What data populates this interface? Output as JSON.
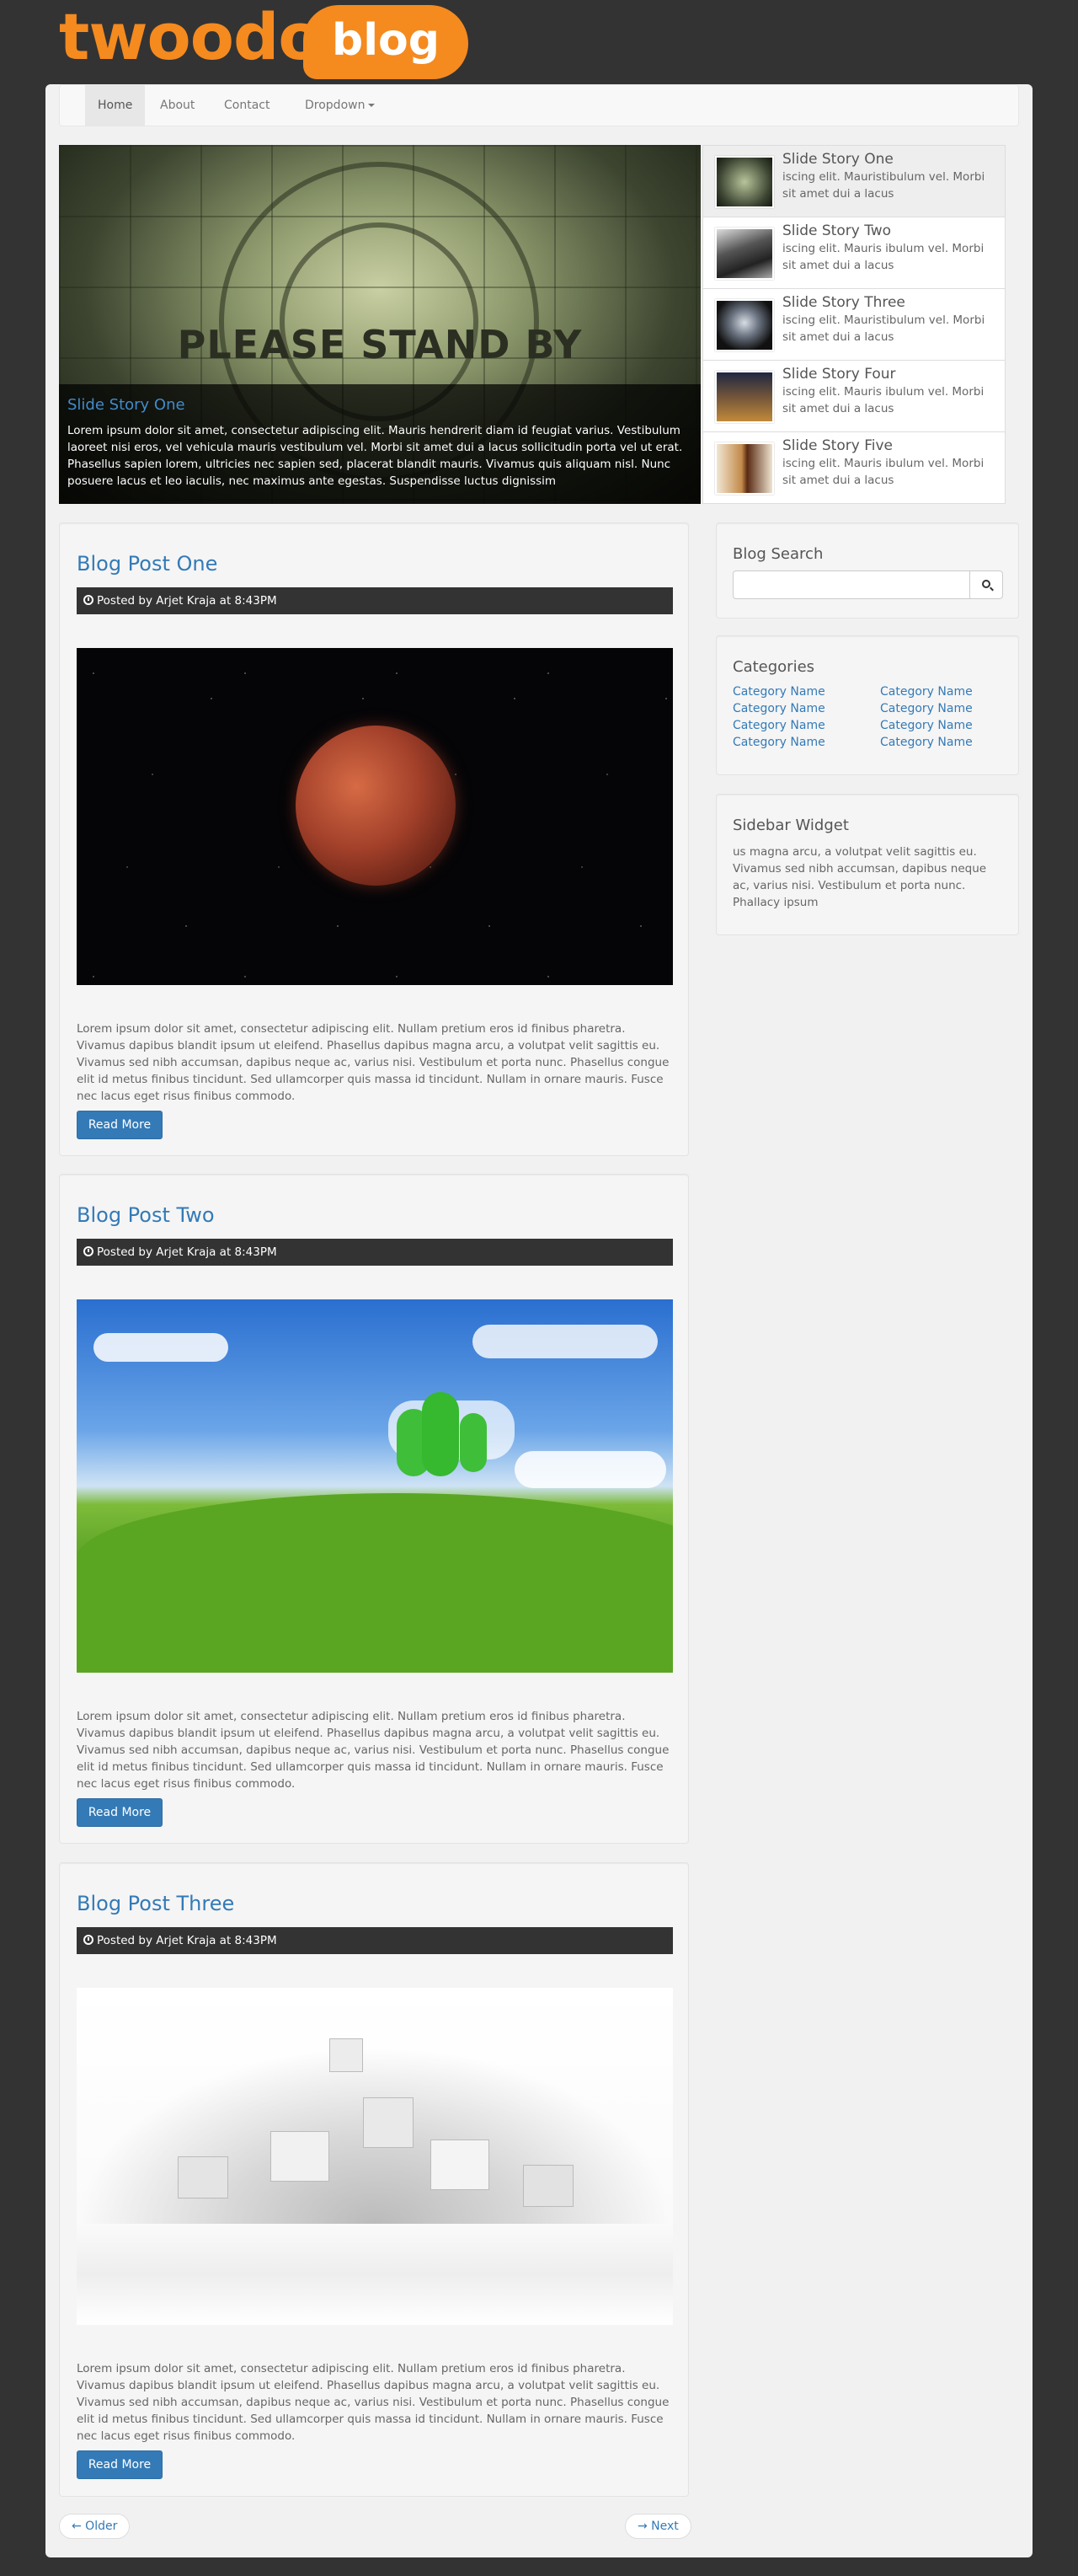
{
  "brand": {
    "name": "twoodo",
    "badge": "blog",
    "accent": "#f58a1f"
  },
  "nav": {
    "items": [
      {
        "label": "Home",
        "active": true
      },
      {
        "label": "About"
      },
      {
        "label": "Contact"
      },
      {
        "label": "Dropdown"
      }
    ]
  },
  "hero": {
    "image_text": "PLEASE STAND BY",
    "caption_title": "Slide Story One",
    "caption_text": "Lorem ipsum dolor sit amet, consectetur adipiscing elit. Mauris hendrerit diam id feugiat varius. Vestibulum laoreet nisi eros, vel vehicula mauris vestibulum vel. Morbi sit amet dui a lacus sollicitudin porta vel ut erat. Phasellus sapien lorem, ultricies nec sapien sed, placerat blandit mauris. Vivamus quis aliquam nisl. Nunc posuere lacus et leo iaculis, nec maximus ante egestas. Suspendisse luctus dignissim"
  },
  "slides": [
    {
      "title": "Slide Story One",
      "desc": "iscing elit. Mauristibulum vel. Morbi sit amet dui a lacus",
      "active": true
    },
    {
      "title": "Slide Story Two",
      "desc": "iscing elit. Mauris ibulum vel. Morbi sit amet dui a lacus"
    },
    {
      "title": "Slide Story Three",
      "desc": "iscing elit. Mauristibulum vel. Morbi sit amet dui a lacus"
    },
    {
      "title": "Slide Story Four",
      "desc": "iscing elit. Mauris ibulum vel. Morbi sit amet dui a lacus"
    },
    {
      "title": "Slide Story Five",
      "desc": "iscing elit. Mauris ibulum vel. Morbi sit amet dui a lacus"
    }
  ],
  "posts": [
    {
      "title": "Blog Post One",
      "meta": "Posted by Arjet Kraja at 8:43PM",
      "body": "Lorem ipsum dolor sit amet, consectetur adipiscing elit. Nullam pretium eros id finibus pharetra. Vivamus dapibus blandit ipsum ut eleifend. Phasellus dapibus magna arcu, a volutpat velit sagittis eu. Vivamus sed nibh accumsan, dapibus neque ac, varius nisi. Vestibulum et porta nunc. Phasellus congue elit id metus finibus tincidunt. Sed ullamcorper quis massa id tincidunt. Nullam in ornare mauris. Fusce nec lacus eget risus finibus commodo.",
      "button": "Read More"
    },
    {
      "title": "Blog Post Two",
      "meta": "Posted by Arjet Kraja at 8:43PM",
      "body": "Lorem ipsum dolor sit amet, consectetur adipiscing elit. Nullam pretium eros id finibus pharetra. Vivamus dapibus blandit ipsum ut eleifend. Phasellus dapibus magna arcu, a volutpat velit sagittis eu. Vivamus sed nibh accumsan, dapibus neque ac, varius nisi. Vestibulum et porta nunc. Phasellus congue elit id metus finibus tincidunt. Sed ullamcorper quis massa id tincidunt. Nullam in ornare mauris. Fusce nec lacus eget risus finibus commodo.",
      "button": "Read More"
    },
    {
      "title": "Blog Post Three",
      "meta": "Posted by Arjet Kraja at 8:43PM",
      "body": "Lorem ipsum dolor sit amet, consectetur adipiscing elit. Nullam pretium eros id finibus pharetra. Vivamus dapibus blandit ipsum ut eleifend. Phasellus dapibus magna arcu, a volutpat velit sagittis eu. Vivamus sed nibh accumsan, dapibus neque ac, varius nisi. Vestibulum et porta nunc. Phasellus congue elit id metus finibus tincidunt. Sed ullamcorper quis massa id tincidunt. Nullam in ornare mauris. Fusce nec lacus eget risus finibus commodo.",
      "button": "Read More"
    }
  ],
  "sidebar": {
    "search": {
      "title": "Blog Search",
      "placeholder": ""
    },
    "categories": {
      "title": "Categories",
      "items": [
        "Category Name",
        "Category Name",
        "Category Name",
        "Category Name",
        "Category Name",
        "Category Name",
        "Category Name",
        "Category Name"
      ]
    },
    "widget": {
      "title": "Sidebar Widget",
      "text": "us magna arcu, a volutpat velit sagittis eu. Vivamus sed nibh accumsan, dapibus neque ac, varius nisi. Vestibulum et porta nunc. Phallacy ipsum"
    }
  },
  "pager": {
    "older": "← Older",
    "newer": "→ Next"
  }
}
